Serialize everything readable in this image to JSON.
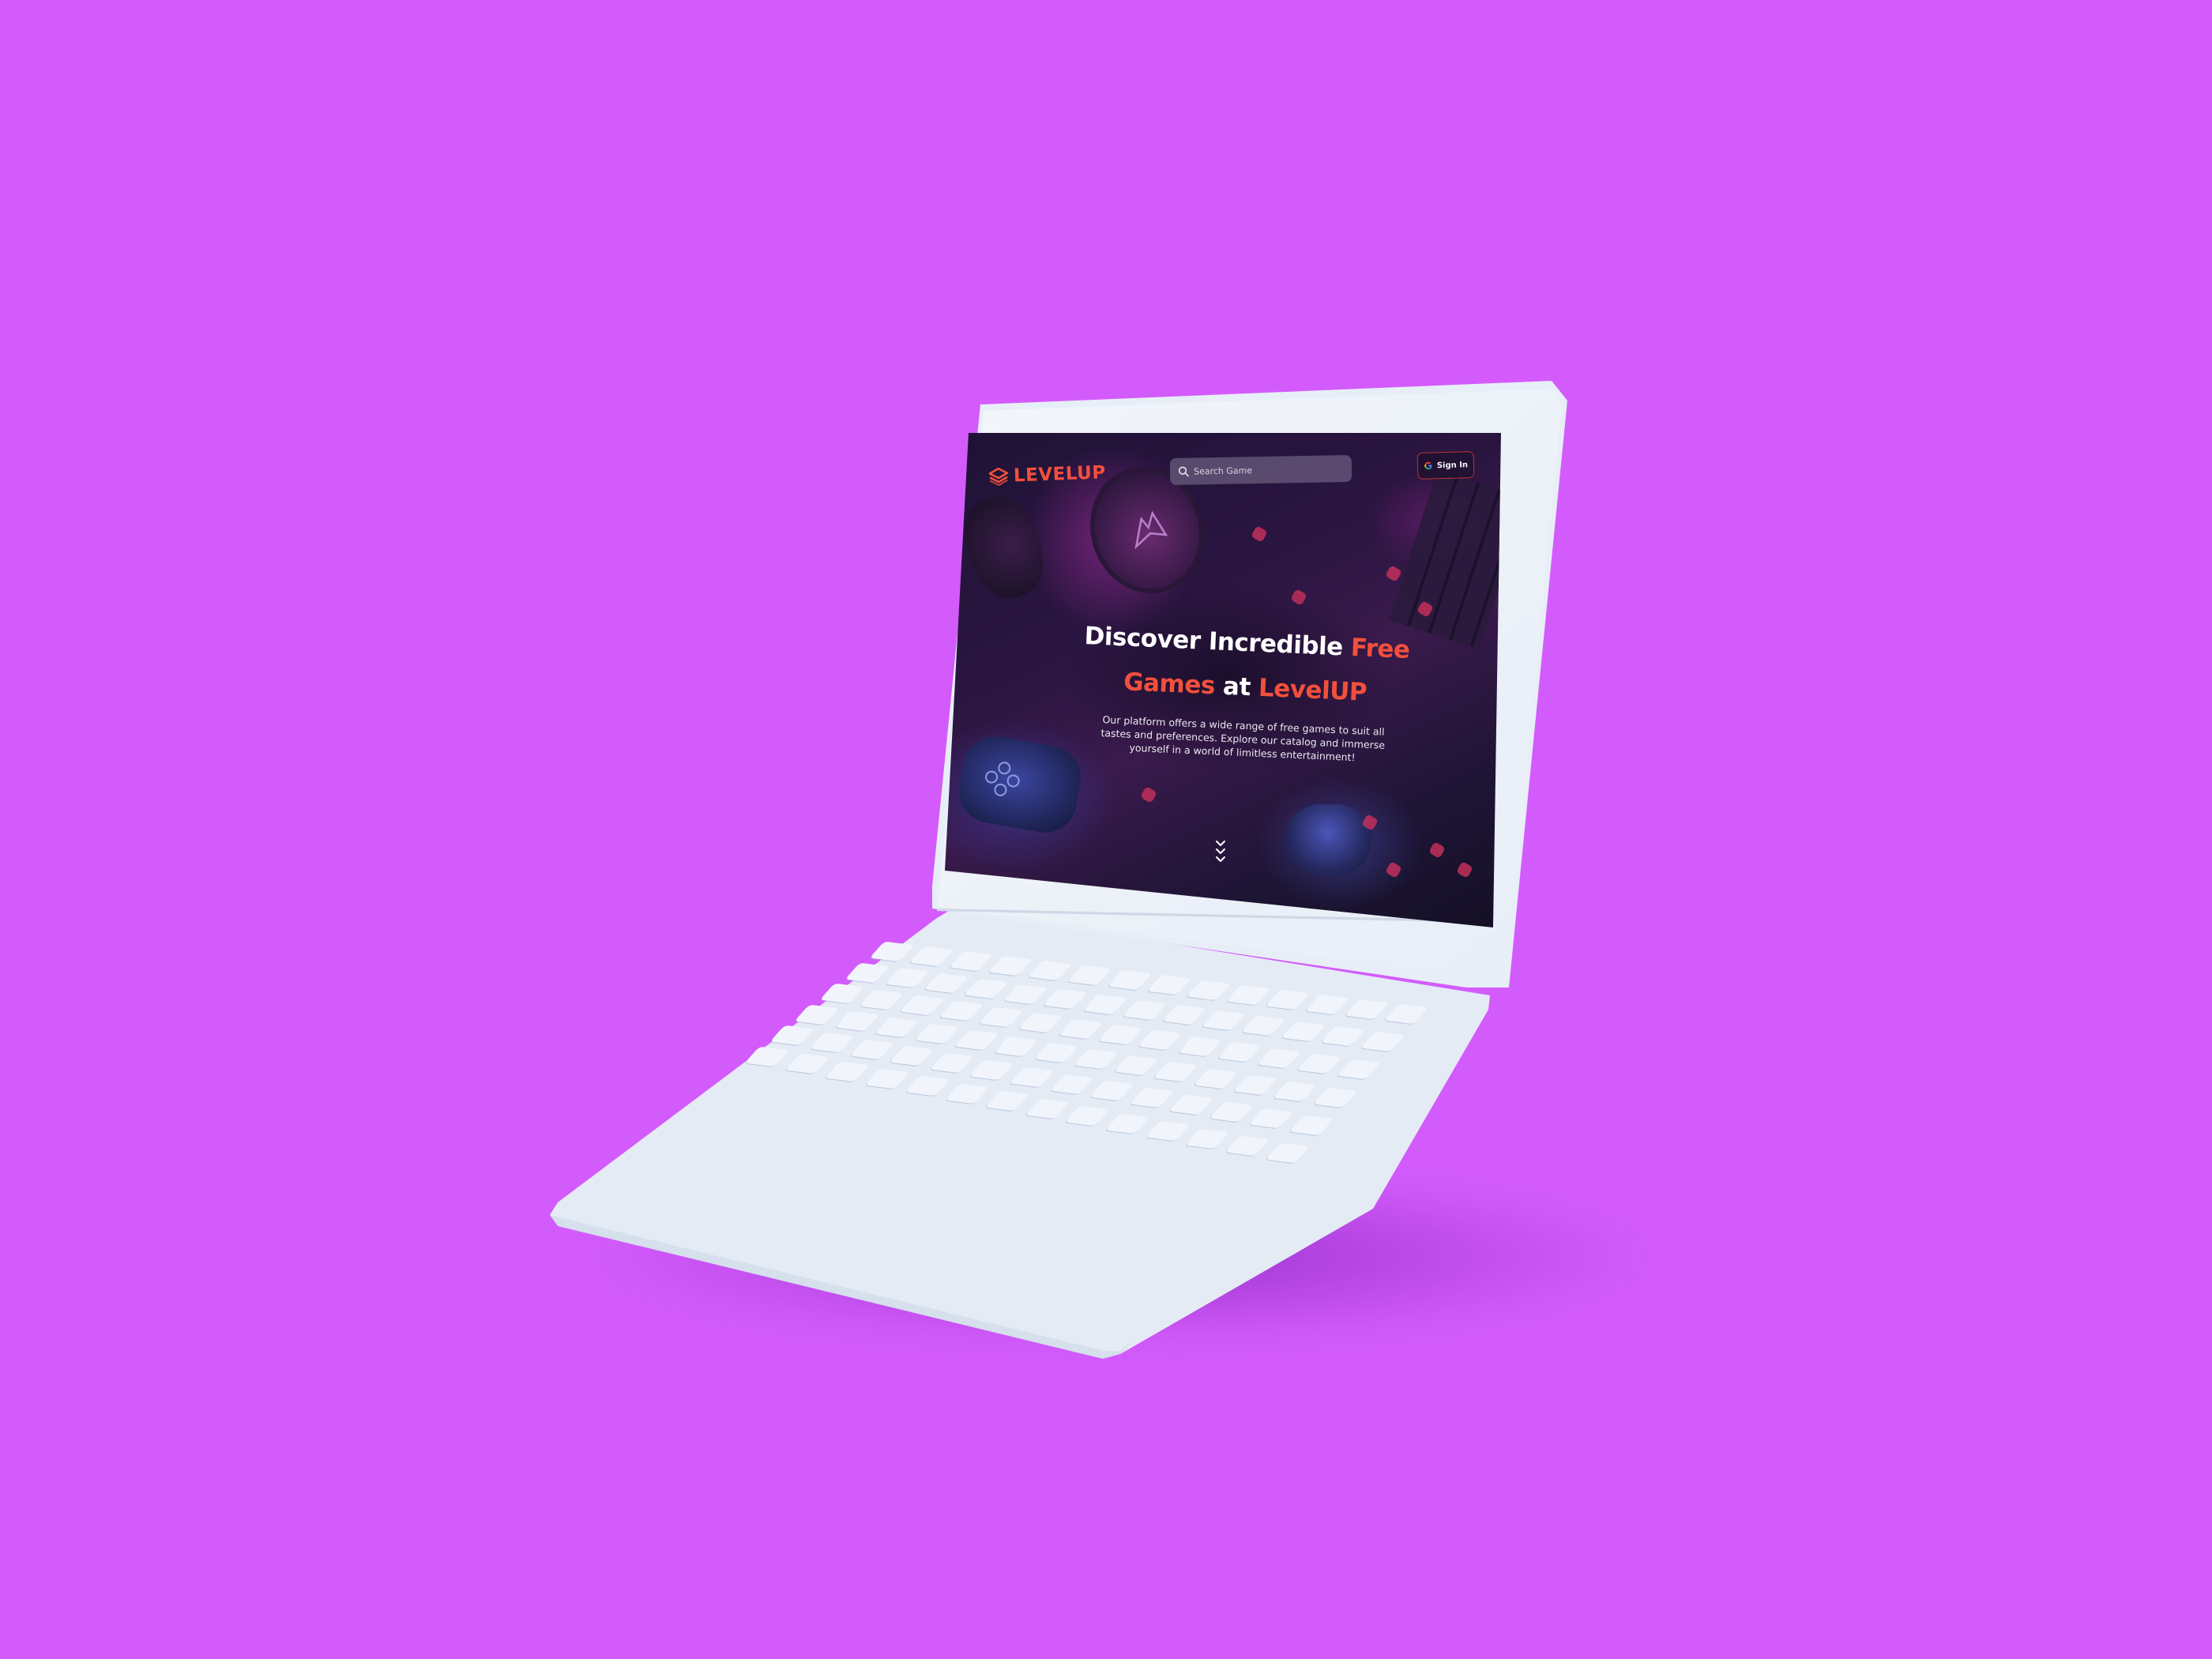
{
  "brand": {
    "name": "LEVELUP",
    "accent_color": "#f2503c",
    "background_color": "#d35bfc"
  },
  "navbar": {
    "logo_icon": "stacked-layers-icon",
    "search": {
      "icon": "search-icon",
      "placeholder": "Search Game"
    },
    "signin": {
      "icon": "google-icon",
      "label": "Sign In"
    }
  },
  "hero": {
    "line1_white": "Discover Incredible",
    "line1_accent": "Free",
    "line2_accent_a": "Games",
    "line2_white": "at",
    "line2_accent_b": "LevelUP",
    "description": "Our platform offers a wide range of free games to suit all tastes and preferences. Explore our catalog and immerse yourself in a world of limitless entertainment!",
    "scroll_icon": "chevrons-down-icon"
  }
}
